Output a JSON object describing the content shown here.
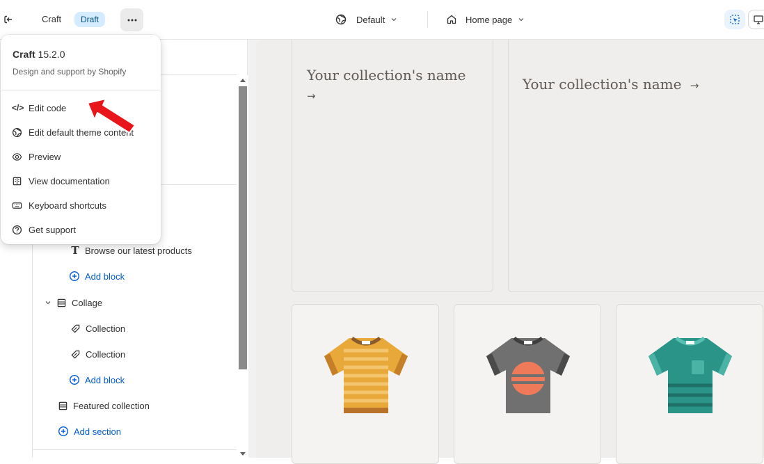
{
  "topbar": {
    "theme_name": "Craft",
    "status_badge": "Draft",
    "theme_selector": "Default",
    "page_selector": "Home page"
  },
  "popover": {
    "title_bold": "Craft",
    "title_version": " 15.2.0",
    "subtitle": "Design and support by Shopify",
    "items": [
      {
        "label": "Edit code",
        "icon": "code-icon"
      },
      {
        "label": "Edit default theme content",
        "icon": "globe-icon"
      },
      {
        "label": "Preview",
        "icon": "eye-icon"
      },
      {
        "label": "View documentation",
        "icon": "book-icon"
      },
      {
        "label": "Keyboard shortcuts",
        "icon": "keyboard-icon"
      },
      {
        "label": "Get support",
        "icon": "question-icon"
      }
    ]
  },
  "sidebar": {
    "tree": [
      {
        "label": "Browse our latest products",
        "icon": "text-icon"
      },
      {
        "label": "Add block",
        "icon": "plus-circle-icon"
      },
      {
        "label": "Collage",
        "icon": "section-icon"
      },
      {
        "label": "Collection",
        "icon": "tag-icon"
      },
      {
        "label": "Collection",
        "icon": "tag-icon"
      },
      {
        "label": "Add block",
        "icon": "plus-circle-icon"
      },
      {
        "label": "Featured collection",
        "icon": "section-icon"
      },
      {
        "label": "Add section",
        "icon": "plus-circle-icon"
      }
    ]
  },
  "preview": {
    "collection_left": "Your collection's name",
    "collection_right": "Your collection's name",
    "arrow": "→",
    "colors": {
      "tee_orange": "#e19a2f",
      "tee_gray": "#6b6b6b",
      "tee_teal": "#2a9488",
      "annotation_arrow": "#e8151b"
    }
  }
}
